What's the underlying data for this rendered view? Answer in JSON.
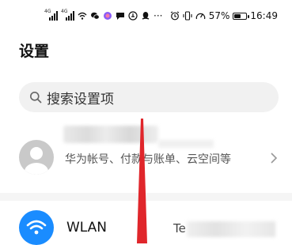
{
  "status_bar": {
    "signal_tag_1": "4G",
    "signal_tag_2": "4G",
    "battery_percent": "57%",
    "battery_level": 0.57,
    "time": "16:49",
    "app_icons": [
      "wifi-icon",
      "wechat-icon",
      "color-app-icon",
      "message-icon",
      "app-icon",
      "qq-icon",
      "more-icon"
    ]
  },
  "page": {
    "title": "设置"
  },
  "search": {
    "placeholder": "搜索设置项"
  },
  "account": {
    "description": "华为帐号、付款与账单、云空间等"
  },
  "wlan": {
    "label": "WLAN",
    "value_prefix": "Te"
  },
  "colors": {
    "wlan_icon_bg": "#1a8cff",
    "arrow": "#e0262b"
  }
}
